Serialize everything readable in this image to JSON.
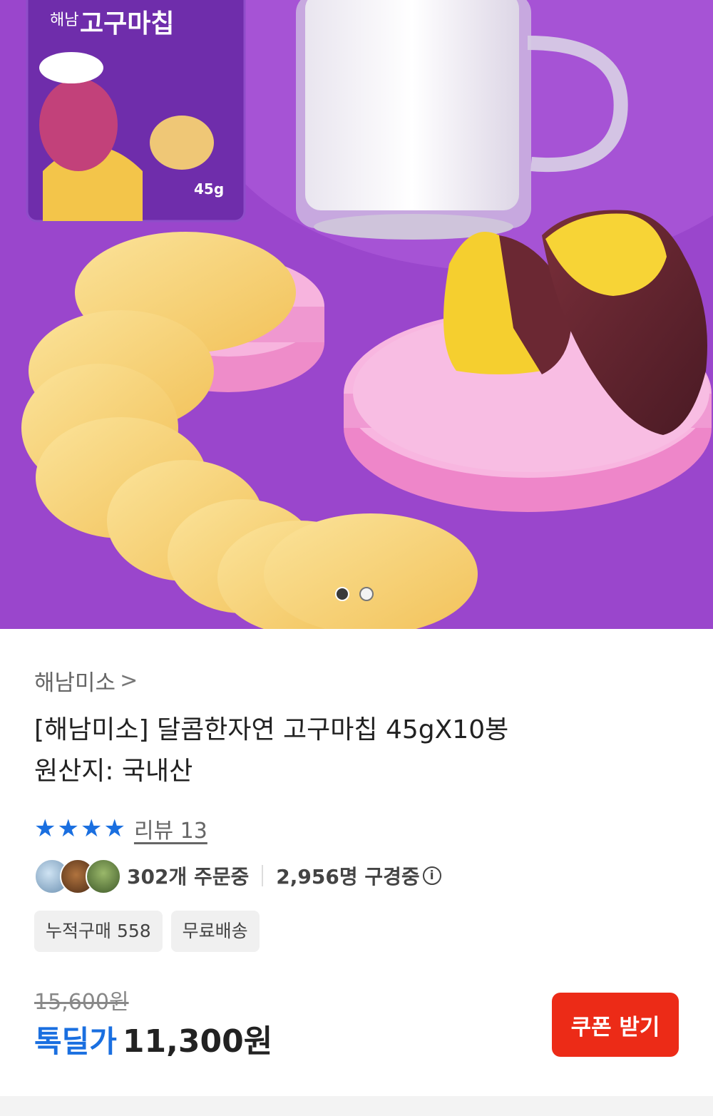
{
  "product_image": {
    "package_brand": "해남",
    "package_title": "고구마칩",
    "package_weight": "45g",
    "carousel": {
      "count": 2,
      "active_index": 0
    }
  },
  "seller": {
    "name": "해남미소",
    "chevron": ">"
  },
  "title": "[해남미소] 달콤한자연 고구마칩 45gX10봉",
  "origin": "원산지: 국내산",
  "rating": {
    "stars": 4,
    "stars_glyph": "★",
    "review_label": "리뷰 13"
  },
  "social_proof": {
    "orders": "302개 주문중",
    "viewers": "2,956명 구경중",
    "info_icon": "info-icon"
  },
  "tags": [
    "누적구매 558",
    "무료배송"
  ],
  "pricing": {
    "original": "15,600원",
    "deal_label": "톡딜가",
    "deal_price": "11,300원"
  },
  "coupon_button": {
    "label": "쿠폰 받기"
  },
  "colors": {
    "accent_blue": "#1a6fe0",
    "coupon_red": "#ec2b17",
    "hero_purple": "#a24ed0"
  }
}
